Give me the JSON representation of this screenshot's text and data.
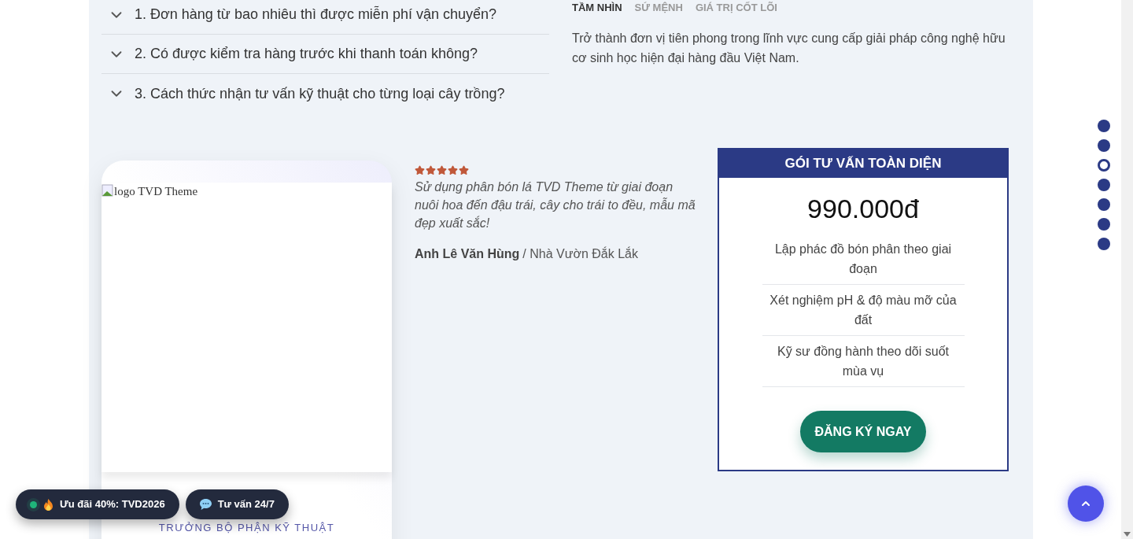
{
  "faq": [
    {
      "question": "1. Đơn hàng từ bao nhiêu thì được miễn phí vận chuyển?",
      "expanded": false
    },
    {
      "question": "2. Có được kiểm tra hàng trước khi thanh toán không?",
      "expanded": false
    },
    {
      "question": "3. Cách thức nhận tư vấn kỹ thuật cho từng loại cây trồng?",
      "expanded": false
    }
  ],
  "about_tabs": [
    {
      "label": "TẦM NHÌN",
      "selected": true
    },
    {
      "label": "SỨ MỆNH",
      "selected": false
    },
    {
      "label": "GIÁ TRỊ CỐT LÕI",
      "selected": false
    }
  ],
  "about_text": "Trở thành đơn vị tiên phong trong lĩnh vực cung cấp giải pháp công nghệ hữu cơ sinh học hiện đại hàng đầu Việt Nam.",
  "expert_card": {
    "image_alt": "logo TVD Theme",
    "role": "TRƯỞNG BỘ PHẬN KỸ THUẬT"
  },
  "testimonial": {
    "stars": 5,
    "quote": "Sử dụng phân bón lá TVD Theme từ giai đoạn nuôi hoa đến đậu trái, cây cho trái to đều, mẫu mã đẹp xuất sắc!",
    "author": "Anh Lê Văn Hùng",
    "place": "/ Nhà Vườn Đắk Lắk"
  },
  "package": {
    "title": "GÓI TƯ VẤN TOÀN DIỆN",
    "price": "990.000đ",
    "features": [
      "Lập phác đồ bón phân theo giai đoạn",
      "Xét nghiệm pH & độ màu mỡ của đất",
      "Kỹ sư đồng hành theo dõi suốt mùa vụ"
    ],
    "button": "ĐĂNG KÝ NGAY"
  },
  "section_dots": [
    {
      "selected": false
    },
    {
      "selected": false
    },
    {
      "selected": true
    },
    {
      "selected": false
    },
    {
      "selected": false
    },
    {
      "selected": false
    },
    {
      "selected": false
    }
  ],
  "floating_pills": [
    {
      "kind": "promo",
      "label": "Ưu đãi 40%: TVD2026"
    },
    {
      "kind": "chat",
      "label": "Tư vấn 24/7"
    }
  ]
}
